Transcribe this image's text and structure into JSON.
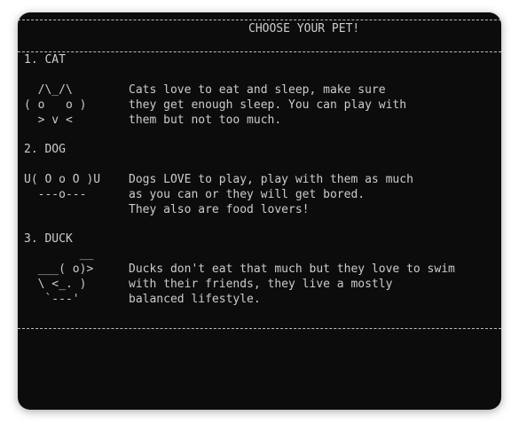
{
  "title": "CHOOSE YOUR PET!",
  "pets": [
    {
      "heading": "1. CAT",
      "art": [
        "  /\\_/\\",
        "( o   o )",
        "  > v <"
      ],
      "description": [
        "Cats love to eat and sleep, make sure",
        "they get enough sleep. You can play with",
        "them but not too much."
      ]
    },
    {
      "heading": "2. DOG",
      "art": [
        "U( O o O )U",
        "  ---o---"
      ],
      "description": [
        "Dogs LOVE to play, play with them as much",
        "as you can or they will get bored.",
        "They also are food lovers!"
      ]
    },
    {
      "heading": "3. DUCK",
      "art": [
        "        __",
        "  ___( o)>",
        "  \\ <_. )",
        "   `---'"
      ],
      "description": [
        "Ducks don't eat that much but they love to swim",
        "with their friends, they live a mostly",
        "balanced lifestyle."
      ]
    }
  ]
}
